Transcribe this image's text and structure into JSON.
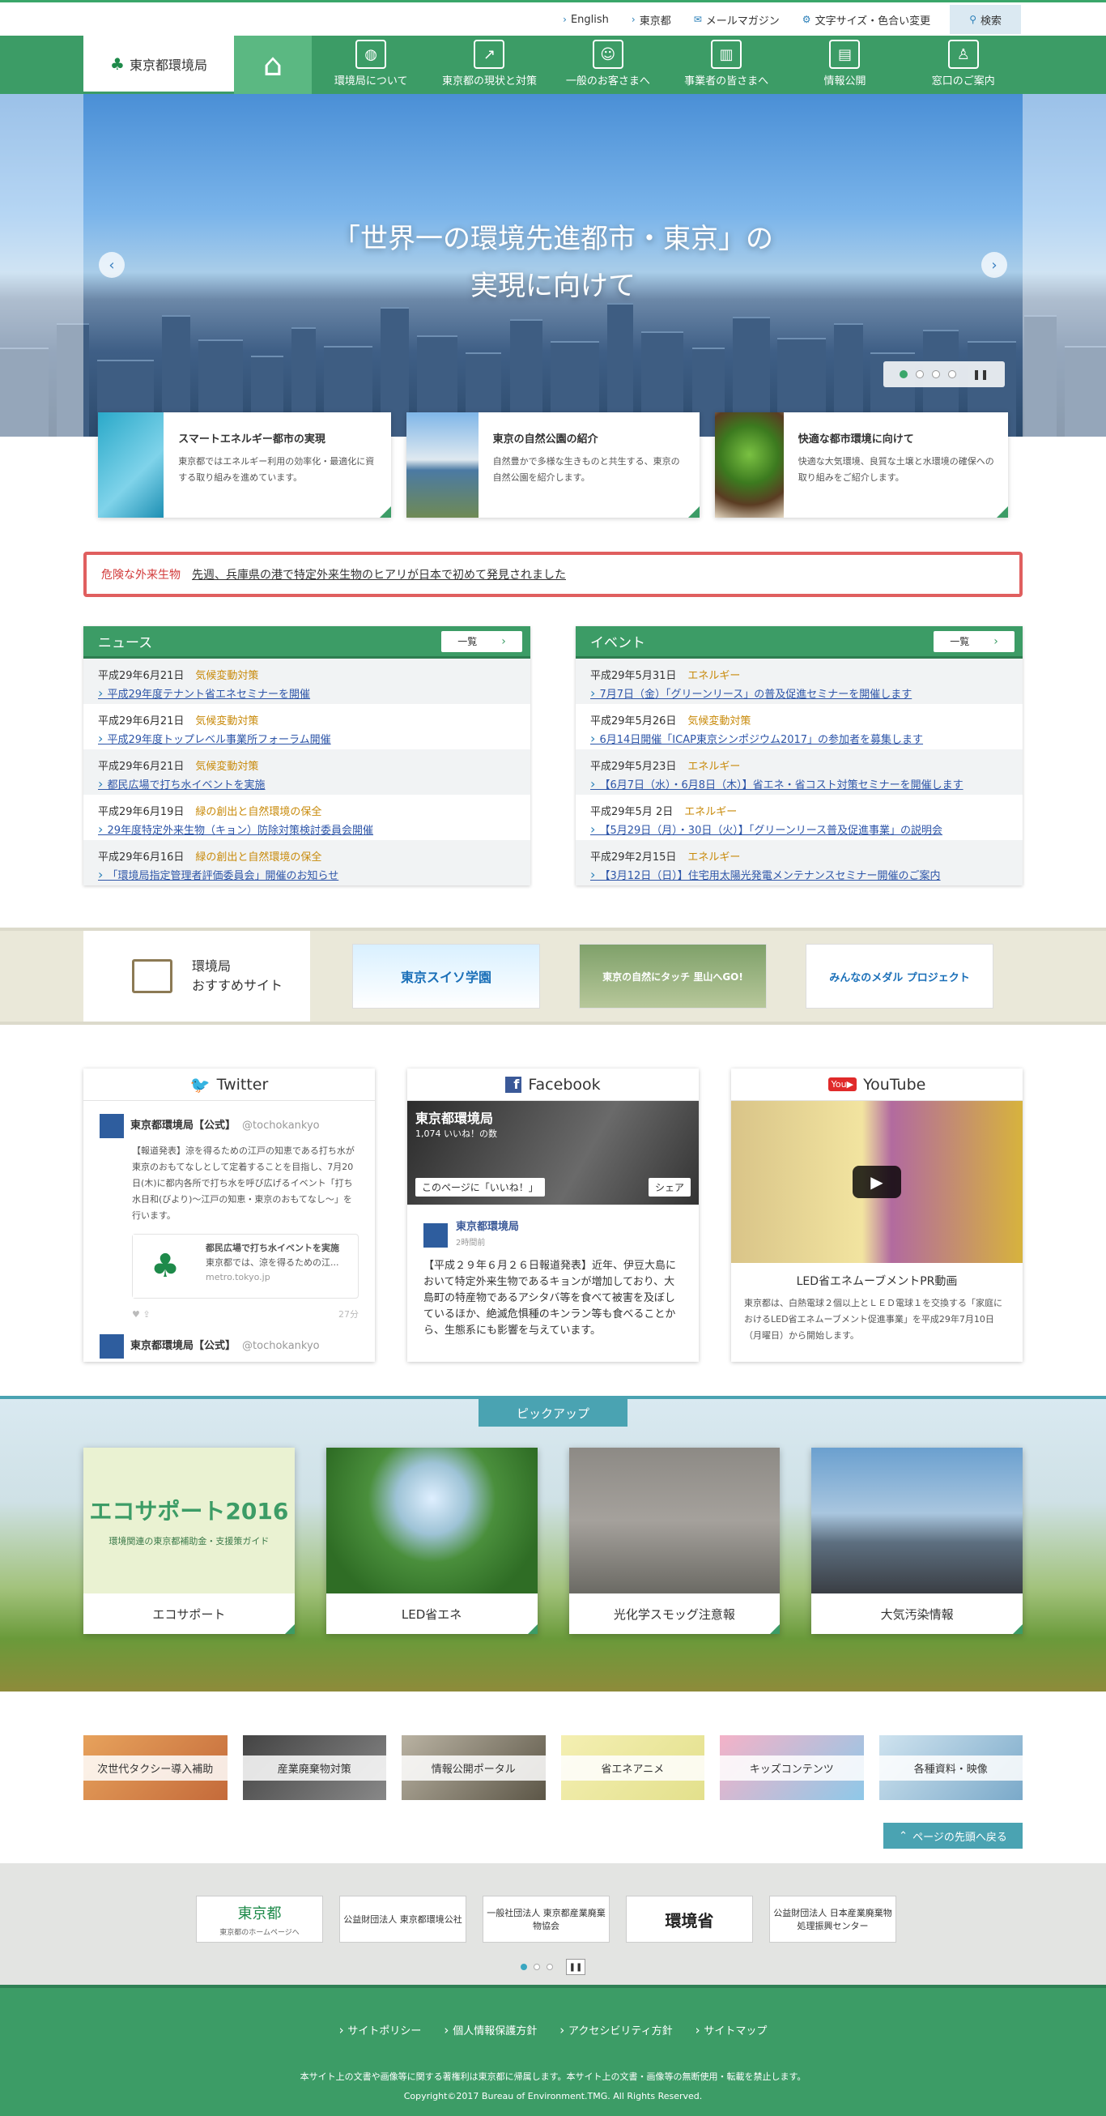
{
  "utility": {
    "english": "English",
    "tokyo": "東京都",
    "mail": "メールマガジン",
    "fontsize": "文字サイズ・色合い変更",
    "search": "検索"
  },
  "nav": {
    "logo": "東京都環境局",
    "items": [
      "環境局について",
      "東京都の現状と対策",
      "一般のお客さまへ",
      "事業者の皆さまへ",
      "情報公開",
      "窓口のご案内"
    ]
  },
  "hero": {
    "line1": "「世界一の環境先進都市・東京」の",
    "line2": "実現に向けて",
    "pause": "❚❚"
  },
  "features": [
    {
      "title": "スマートエネルギー都市の実現",
      "desc": "東京都ではエネルギー利用の効率化・最適化に資する取り組みを進めています。"
    },
    {
      "title": "東京の自然公園の紹介",
      "desc": "自然豊かで多様な生きものと共生する、東京の自然公園を紹介します。"
    },
    {
      "title": "快適な都市環境に向けて",
      "desc": "快適な大気環境、良質な土壌と水環境の確保への取り組みをご紹介します。"
    }
  ],
  "alert": {
    "tag": "危険な外来生物",
    "message": "先週、兵庫県の港で特定外来生物のヒアリが日本で初めて発見されました"
  },
  "news": {
    "title": "ニュース",
    "more": "一覧",
    "items": [
      {
        "date": "平成29年6月21日",
        "cat": "気候変動対策",
        "title": "平成29年度テナント省エネセミナーを開催"
      },
      {
        "date": "平成29年6月21日",
        "cat": "気候変動対策",
        "title": "平成29年度トップレベル事業所フォーラム開催"
      },
      {
        "date": "平成29年6月21日",
        "cat": "気候変動対策",
        "title": "都民広場で打ち水イベントを実施"
      },
      {
        "date": "平成29年6月19日",
        "cat": "緑の創出と自然環境の保全",
        "title": "29年度特定外来生物（キョン）防除対策検討委員会開催"
      },
      {
        "date": "平成29年6月16日",
        "cat": "緑の創出と自然環境の保全",
        "title": "「環境局指定管理者評価委員会」開催のお知らせ"
      }
    ]
  },
  "events": {
    "title": "イベント",
    "more": "一覧",
    "items": [
      {
        "date": "平成29年5月31日",
        "cat": "エネルギー",
        "title": "7月7日（金）「グリーンリース」の普及促進セミナーを開催します"
      },
      {
        "date": "平成29年5月26日",
        "cat": "気候変動対策",
        "title": "6月14日開催「ICAP東京シンポジウム2017」の参加者を募集します"
      },
      {
        "date": "平成29年5月23日",
        "cat": "エネルギー",
        "title": "【6月7日（水）・6月8日（木）】省エネ・省コスト対策セミナーを開催します"
      },
      {
        "date": "平成29年5月 2日",
        "cat": "エネルギー",
        "title": "【5月29日（月）・30日（火）】「グリーンリース普及促進事業」の説明会"
      },
      {
        "date": "平成29年2月15日",
        "cat": "エネルギー",
        "title": "【3月12日（日）】住宅用太陽光発電メンテナンスセミナー開催のご案内"
      }
    ]
  },
  "recommend": {
    "label1": "環境局",
    "label2": "おすすめサイト",
    "banners": [
      "東京スイソ学園",
      "東京の自然にタッチ 里山へGO!",
      "みんなのメダル プロジェクト"
    ]
  },
  "social": {
    "twitter": {
      "title": "Twitter",
      "user": "東京都環境局【公式】",
      "handle": "@tochokankyo",
      "text": "【報道発表】涼を得るための江戸の知恵である打ち水が東京のおもてなしとして定着することを目指し、7月20日(木)に都内各所で打ち水を呼び広げるイベント「打ち水日和(びより)～江戸の知恵・東京のおもてなし～」を行います。",
      "card_title": "都民広場で打ち水イベントを実施",
      "card_text": "東京都では、涼を得るための江...",
      "card_url": "metro.tokyo.jp",
      "time": "27分"
    },
    "facebook": {
      "title": "Facebook",
      "page": "東京都環境局",
      "likes": "1,074 いいね！の数",
      "like_btn": "このページに「いいね！」",
      "share_btn": "シェア",
      "ago": "2時間前",
      "post": "【平成２９年６月２６日報道発表】近年、伊豆大島において特定外来生物であるキョンが増加しており、大島町の特産物であるアシタバ等を食べて被害を及ぼしているほか、絶滅危惧種のキンラン等も食べることから、生態系にも影響を与えています。"
    },
    "youtube": {
      "title": "YouTube",
      "video_title": "LED省エネムーブメントPR動画",
      "desc": "東京都は、白熱電球２個以上とＬＥＤ電球１を交換する「家庭におけるLED省エネムーブメント促進事業」を平成29年7月10日（月曜日）から開始します。"
    }
  },
  "pickup": {
    "title": "ピックアップ",
    "items": [
      "エコサポート",
      "LED省エネ",
      "光化学スモッグ注意報",
      "大気汚染情報"
    ],
    "eco_banner": "エコサポート2016",
    "eco_sub": "環境関連の東京都補助金・支援策ガイド"
  },
  "small_banners": [
    "次世代タクシー導入補助",
    "産業廃棄物対策",
    "情報公開ポータル",
    "省エネアニメ",
    "キッズコンテンツ",
    "各種資料・映像"
  ],
  "back_to_top": "ページの先頭へ戻る",
  "related": {
    "tokyo": "東京都",
    "tokyo_sub": "東京都のホームページへ",
    "kosha": "公益財団法人 東京都環境公社",
    "sanpai": "一般社団法人 東京都産業廃棄物協会",
    "moe": "環境省",
    "jw": "公益財団法人 日本産業廃棄物処理振興センター"
  },
  "footer": {
    "links": [
      "サイトポリシー",
      "個人情報保護方針",
      "アクセシビリティ方針",
      "サイトマップ"
    ],
    "notice": "本サイト上の文書や画像等に関する著権利は東京都に帰属します。本サイト上の文書・画像等の無断使用・転載を禁止します。",
    "copyright": "Copyright©2017 Bureau of Environment.TMG. All Rights Reserved."
  }
}
